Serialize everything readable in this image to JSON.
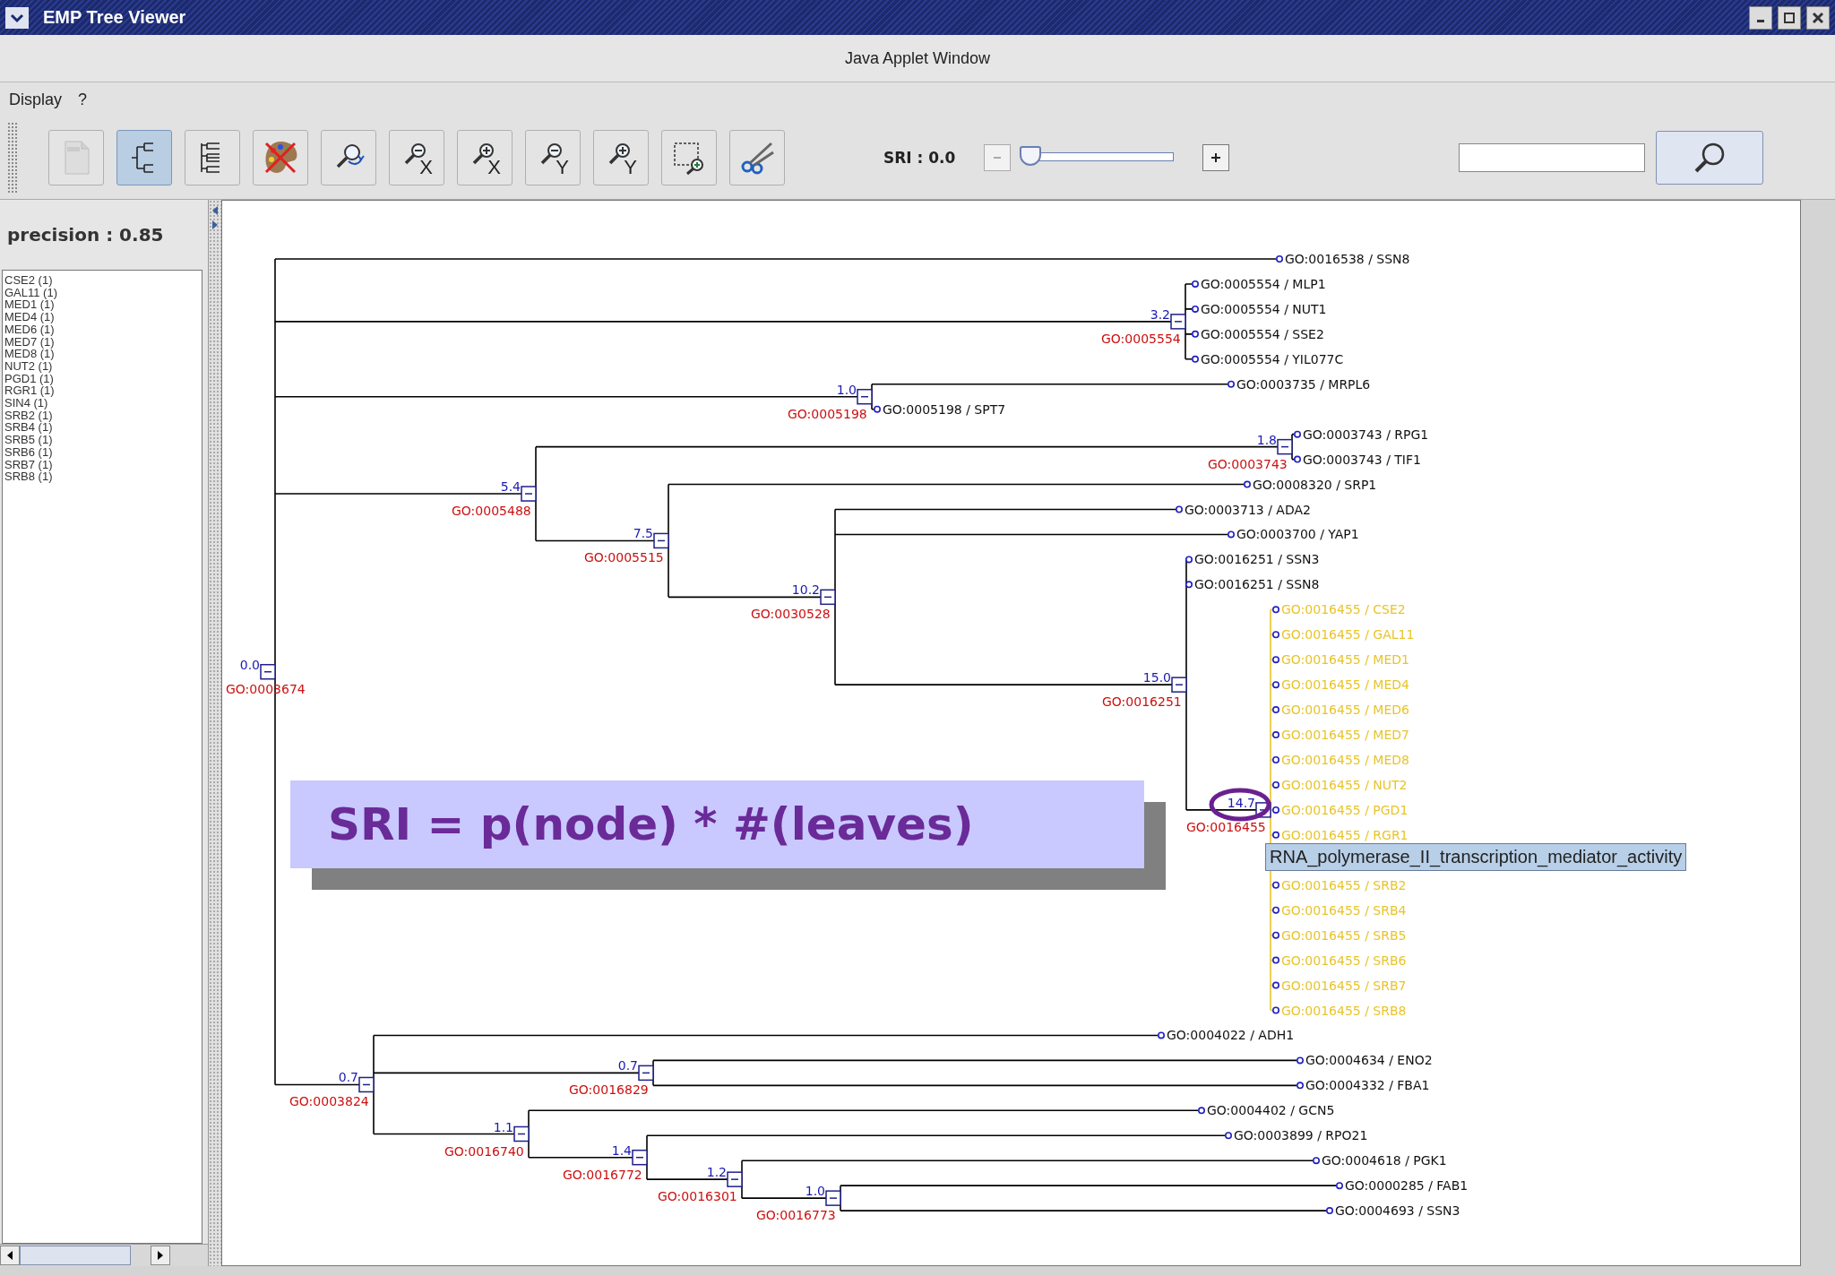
{
  "window": {
    "title": "EMP Tree Viewer"
  },
  "applet_bar": {
    "title": "Java Applet Window"
  },
  "menu": [
    "Display",
    "?"
  ],
  "toolbar": {
    "buttons": [
      {
        "kind": "pdf",
        "selected": false,
        "disabled": true
      },
      {
        "kind": "tree",
        "selected": true,
        "disabled": false
      },
      {
        "kind": "tree-list",
        "selected": false,
        "disabled": false
      },
      {
        "kind": "palette-off",
        "selected": false,
        "disabled": false
      },
      {
        "kind": "zoom-reset",
        "selected": false,
        "disabled": false
      },
      {
        "kind": "zoom-out",
        "label": "X",
        "selected": false,
        "disabled": false
      },
      {
        "kind": "zoom-in",
        "label": "X",
        "selected": false,
        "disabled": false
      },
      {
        "kind": "zoom-out",
        "label": "Y",
        "selected": false,
        "disabled": false
      },
      {
        "kind": "zoom-in",
        "label": "Y",
        "selected": false,
        "disabled": false
      },
      {
        "kind": "zoom-box",
        "selected": false,
        "disabled": false
      },
      {
        "kind": "scissors",
        "selected": false,
        "disabled": false
      }
    ]
  },
  "sri": {
    "label": "SRI : 0.0",
    "minus_disabled": true,
    "level": 0,
    "plus_disabled": false
  },
  "side_panel": {
    "precision": "precision : 0.85",
    "genes": [
      "CSE2 (1)",
      "GAL11 (1)",
      "MED1 (1)",
      "MED4 (1)",
      "MED6 (1)",
      "MED7 (1)",
      "MED8 (1)",
      "NUT2 (1)",
      "PGD1 (1)",
      "RGR1 (1)",
      "SIN4 (1)",
      "SRB2 (1)",
      "SRB4 (1)",
      "SRB5 (1)",
      "SRB6 (1)",
      "SRB7 (1)",
      "SRB8 (1)"
    ]
  },
  "tree": {
    "tooltip": "RNA_polymerase_II_transcription_mediator_activity",
    "annotation": "SRI = p(node) * #(leaves)",
    "circle_highlighted": true,
    "root": {
      "score": "0.0",
      "term": "GO:0003674",
      "expanded": true,
      "highlighted": false,
      "children": [
        {
          "label": "GO:0016538 / SSN8",
          "highlighted": false
        },
        {
          "score": "3.2",
          "term": "GO:0005554",
          "expanded": true,
          "highlighted": false,
          "children": [
            {
              "label": "GO:0005554 / MLP1",
              "highlighted": false
            },
            {
              "label": "GO:0005554 / NUT1",
              "highlighted": false
            },
            {
              "label": "GO:0005554 / SSE2",
              "highlighted": false
            },
            {
              "label": "GO:0005554 / YIL077C",
              "highlighted": false
            }
          ]
        },
        {
          "score": "1.0",
          "term": "GO:0005198",
          "expanded": true,
          "highlighted": false,
          "children": [
            {
              "label": "GO:0003735 / MRPL6",
              "highlighted": false
            },
            {
              "label": "GO:0005198 / SPT7",
              "highlighted": false
            }
          ]
        },
        {
          "score": "5.4",
          "term": "GO:0005488",
          "expanded": true,
          "highlighted": false,
          "children": [
            {
              "score": "1.8",
              "term": "GO:0003743",
              "expanded": true,
              "highlighted": false,
              "children": [
                {
                  "label": "GO:0003743 / RPG1",
                  "highlighted": false
                },
                {
                  "label": "GO:0003743 / TIF1",
                  "highlighted": false
                }
              ]
            },
            {
              "score": "7.5",
              "term": "GO:0005515",
              "expanded": true,
              "highlighted": false,
              "children": [
                {
                  "label": "GO:0008320 / SRP1",
                  "highlighted": false
                },
                {
                  "score": "10.2",
                  "term": "GO:0030528",
                  "expanded": true,
                  "highlighted": false,
                  "children": [
                    {
                      "label": "GO:0003713 / ADA2",
                      "highlighted": false
                    },
                    {
                      "label": "GO:0003700 / YAP1",
                      "highlighted": false
                    },
                    {
                      "score": "15.0",
                      "term": "GO:0016251",
                      "expanded": true,
                      "highlighted": false,
                      "children": [
                        {
                          "label": "GO:0016251 / SSN3",
                          "highlighted": false
                        },
                        {
                          "label": "GO:0016251 / SSN8",
                          "highlighted": false
                        },
                        {
                          "score": "14.7",
                          "term": "GO:0016455",
                          "expanded": true,
                          "highlighted": true,
                          "children": [
                            {
                              "label": "GO:0016455 / CSE2",
                              "highlighted": true
                            },
                            {
                              "label": "GO:0016455 / GAL11",
                              "highlighted": true
                            },
                            {
                              "label": "GO:0016455 / MED1",
                              "highlighted": true
                            },
                            {
                              "label": "GO:0016455 / MED4",
                              "highlighted": true
                            },
                            {
                              "label": "GO:0016455 / MED6",
                              "highlighted": true
                            },
                            {
                              "label": "GO:0016455 / MED7",
                              "highlighted": true
                            },
                            {
                              "label": "GO:0016455 / MED8",
                              "highlighted": true
                            },
                            {
                              "label": "GO:0016455 / NUT2",
                              "highlighted": true
                            },
                            {
                              "label": "GO:0016455 / PGD1",
                              "highlighted": true
                            },
                            {
                              "label": "GO:0016455 / RGR1",
                              "highlighted": true
                            },
                            {
                              "label": "GO:0016455 / SRB2",
                              "highlighted": true
                            },
                            {
                              "label": "GO:0016455 / SRB4",
                              "highlighted": true
                            },
                            {
                              "label": "GO:0016455 / SRB5",
                              "highlighted": true
                            },
                            {
                              "label": "GO:0016455 / SRB6",
                              "highlighted": true
                            },
                            {
                              "label": "GO:0016455 / SRB7",
                              "highlighted": true
                            },
                            {
                              "label": "GO:0016455 / SRB8",
                              "highlighted": true
                            }
                          ]
                        }
                      ]
                    }
                  ]
                }
              ]
            }
          ]
        },
        {
          "score": "0.7",
          "term": "GO:0003824",
          "expanded": true,
          "highlighted": false,
          "children": [
            {
              "label": "GO:0004022 / ADH1",
              "highlighted": false
            },
            {
              "score": "0.7",
              "term": "GO:0016829",
              "expanded": true,
              "highlighted": false,
              "children": [
                {
                  "label": "GO:0004634 / ENO2",
                  "highlighted": false
                },
                {
                  "label": "GO:0004332 / FBA1",
                  "highlighted": false
                }
              ]
            },
            {
              "score": "1.1",
              "term": "GO:0016740",
              "expanded": true,
              "highlighted": false,
              "children": [
                {
                  "label": "GO:0004402 / GCN5",
                  "highlighted": false
                },
                {
                  "score": "1.4",
                  "term": "GO:0016772",
                  "expanded": true,
                  "highlighted": false,
                  "children": [
                    {
                      "label": "GO:0003899 / RPO21",
                      "highlighted": false
                    },
                    {
                      "score": "1.2",
                      "term": "GO:0016301",
                      "expanded": true,
                      "highlighted": false,
                      "children": [
                        {
                          "label": "GO:0004618 / PGK1",
                          "highlighted": false
                        },
                        {
                          "score": "1.0",
                          "term": "GO:0016773",
                          "expanded": true,
                          "highlighted": false,
                          "children": [
                            {
                              "label": "GO:0000285 / FAB1",
                              "highlighted": false
                            },
                            {
                              "label": "GO:0004693 / SSN3",
                              "highlighted": false
                            }
                          ]
                        }
                      ]
                    }
                  ]
                }
              ]
            }
          ]
        }
      ]
    }
  }
}
